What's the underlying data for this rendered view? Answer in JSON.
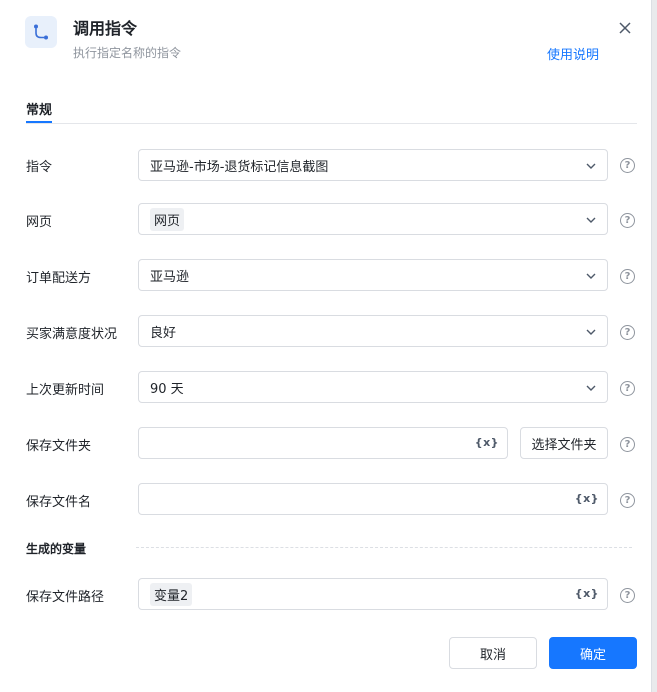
{
  "header": {
    "title": "调用指令",
    "subtitle": "执行指定名称的指令",
    "help_link": "使用说明",
    "icon": "flow-route-icon",
    "close_icon": "close-icon"
  },
  "tabs": [
    {
      "label": "常规",
      "active": true
    }
  ],
  "fields": {
    "command": {
      "label": "指令",
      "value": "亚马逊-市场-退货标记信息截图"
    },
    "webpage": {
      "label": "网页",
      "value": "网页"
    },
    "delivery": {
      "label": "订单配送方",
      "value": "亚马逊"
    },
    "satisfaction": {
      "label": "买家满意度状况",
      "value": "良好"
    },
    "updated": {
      "label": "上次更新时间",
      "value": "90 天"
    },
    "folder": {
      "label": "保存文件夹",
      "value": "",
      "pick_label": "选择文件夹"
    },
    "filename": {
      "label": "保存文件名",
      "value": ""
    }
  },
  "var_token": "{x}",
  "output": {
    "section_title": "生成的变量",
    "path_label": "保存文件路径",
    "path_value": "变量2"
  },
  "footer": {
    "cancel_label": "取消",
    "ok_label": "确定"
  },
  "colors": {
    "accent": "#1677ff",
    "border": "#d9dce1",
    "muted": "#8f959e"
  }
}
